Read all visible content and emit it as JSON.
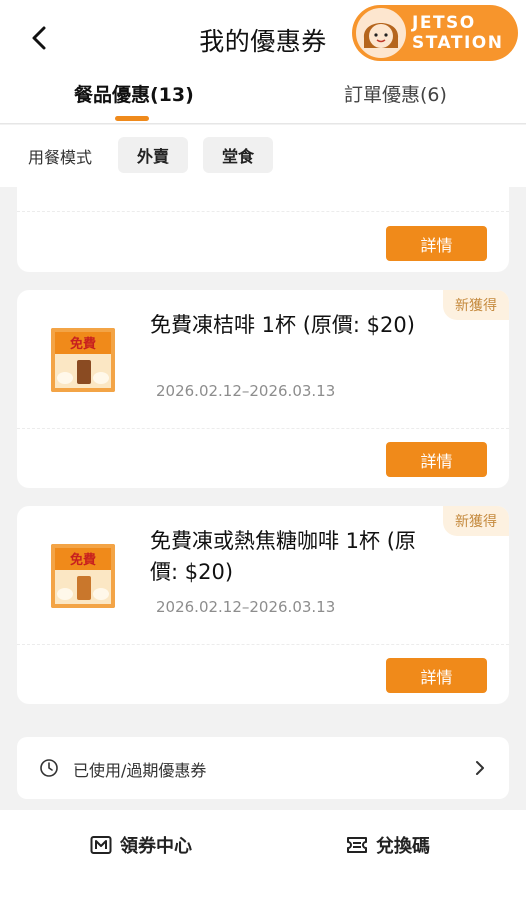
{
  "header": {
    "title": "我的優惠券",
    "logo_line1": "JETSO",
    "logo_line2": "STATION"
  },
  "tabs": [
    {
      "label": "餐品優惠(13)",
      "active": true
    },
    {
      "label": "訂單優惠(6)",
      "active": false
    }
  ],
  "filter": {
    "label": "用餐模式",
    "options": [
      "外賣",
      "堂食"
    ]
  },
  "coupons": [
    {
      "badge": "",
      "title": "",
      "date": "",
      "detail_label": "詳情"
    },
    {
      "badge": "新獲得",
      "thumb_text": "免費",
      "title": "免費凍桔啡 1杯 (原價: $20)",
      "date": "2026.02.12–2026.03.13",
      "detail_label": "詳情"
    },
    {
      "badge": "新獲得",
      "thumb_text": "免費",
      "title": "免費凍或熱焦糖咖啡 1杯 (原價: $20)",
      "date": "2026.02.12–2026.03.13",
      "detail_label": "詳情"
    }
  ],
  "history": {
    "label": "已使用/過期優惠券"
  },
  "bottom_nav": [
    {
      "label": "領券中心",
      "icon": "coupon-center-icon"
    },
    {
      "label": "兌換碼",
      "icon": "redeem-code-icon"
    }
  ],
  "colors": {
    "accent": "#f08a1a",
    "badge_bg": "#fdf1e0",
    "badge_text": "#c58a3e",
    "background": "#f2f2f2"
  }
}
